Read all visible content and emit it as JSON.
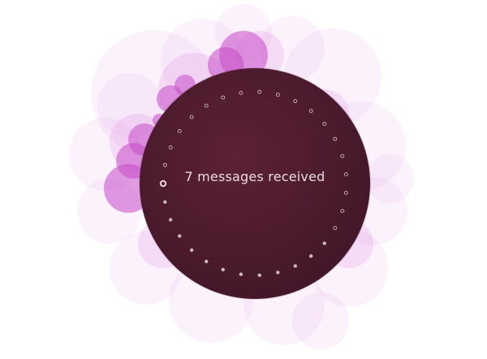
{
  "infographic": {
    "message_text": "7 messages received",
    "message_count": 7,
    "total_dots": 31,
    "filled_dots": 12,
    "current_dot_index": 12
  },
  "colors": {
    "background": "#ffffff",
    "circle_fill": "#4a1a2c",
    "text": "#e9dde1",
    "dot": "#cbb7bf",
    "bubble_light": "#f1d6f2",
    "bubble_strong": "#c74bc9"
  }
}
